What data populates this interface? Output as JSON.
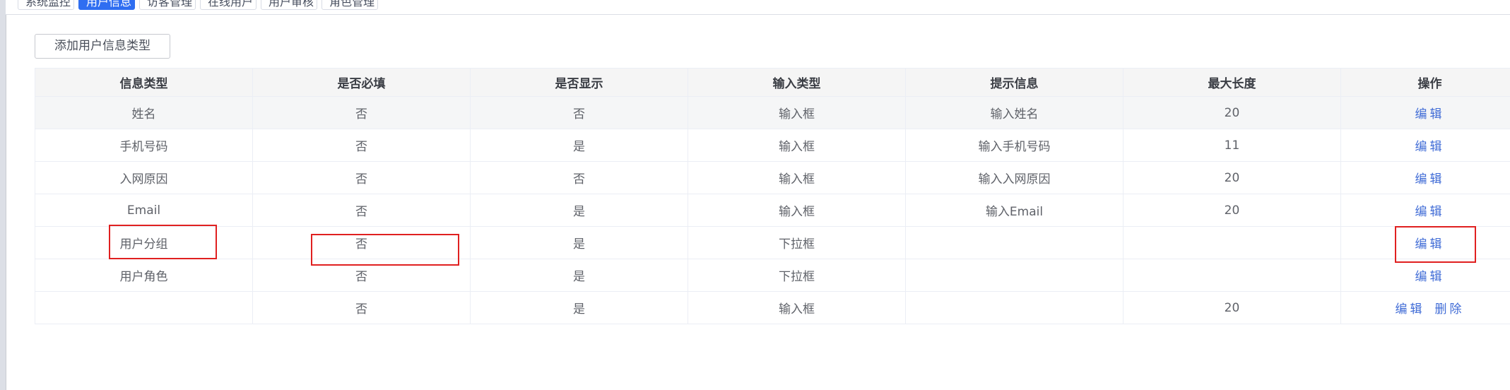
{
  "tabs": [
    {
      "label": "系统监控",
      "active": false
    },
    {
      "label": "用户信息",
      "active": true
    },
    {
      "label": "访客管理",
      "active": false
    },
    {
      "label": "在线用户",
      "active": false
    },
    {
      "label": "用户审核",
      "active": false
    },
    {
      "label": "角色管理",
      "active": false
    }
  ],
  "tab_close_glyph": "×",
  "toolbar": {
    "add_label": "添加用户信息类型"
  },
  "table": {
    "headers": [
      "信息类型",
      "是否必填",
      "是否显示",
      "输入类型",
      "提示信息",
      "最大长度",
      "操作"
    ],
    "rows": [
      {
        "type": "姓名",
        "required": "否",
        "shown": "否",
        "input": "输入框",
        "hint": "输入姓名",
        "maxlen": "20",
        "edit": "编辑"
      },
      {
        "type": "手机号码",
        "required": "否",
        "shown": "是",
        "input": "输入框",
        "hint": "输入手机号码",
        "maxlen": "11",
        "edit": "编辑"
      },
      {
        "type": "入网原因",
        "required": "否",
        "shown": "否",
        "input": "输入框",
        "hint": "输入入网原因",
        "maxlen": "20",
        "edit": "编辑"
      },
      {
        "type": "Email",
        "required": "否",
        "shown": "是",
        "input": "输入框",
        "hint": "输入Email",
        "maxlen": "20",
        "edit": "编辑"
      },
      {
        "type": "用户分组",
        "required": "否",
        "shown": "是",
        "input": "下拉框",
        "hint": "",
        "maxlen": "",
        "edit": "编辑"
      },
      {
        "type": "用户角色",
        "required": "否",
        "shown": "是",
        "input": "下拉框",
        "hint": "",
        "maxlen": "",
        "edit": "编辑"
      },
      {
        "type": "",
        "required": "否",
        "shown": "是",
        "input": "输入框",
        "hint": "",
        "maxlen": "20",
        "edit": "编辑",
        "delete": "删除"
      }
    ]
  },
  "colors": {
    "accent": "#2f6ef1",
    "link": "#3f6bd6",
    "annotation_box": "#e02020"
  }
}
